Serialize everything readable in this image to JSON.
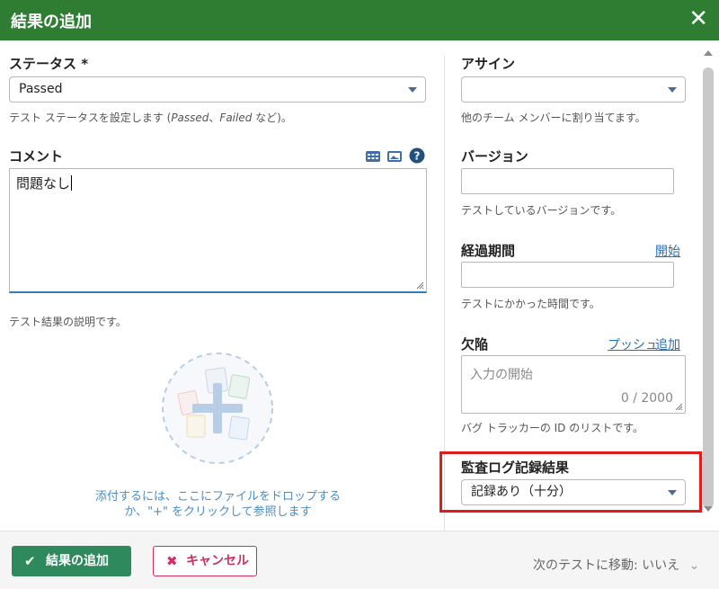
{
  "dialog": {
    "title": "結果の追加",
    "close_icon": "close-icon"
  },
  "left": {
    "status": {
      "label": "ステータス *",
      "value": "Passed",
      "help_prefix": "テスト ステータスを設定します (",
      "help_ex1": "Passed",
      "help_sep": "、",
      "help_ex2": "Failed",
      "help_suffix": " など)。"
    },
    "comment": {
      "label": "コメント",
      "value": "問題なし",
      "help": "テスト結果の説明です。",
      "toolbar_icons": [
        "table-icon",
        "image-icon",
        "help-icon"
      ]
    },
    "dropzone": {
      "line1": "添付するには、ここにファイルをドロップする",
      "line2": "か、\"+\" をクリックして参照します"
    }
  },
  "right": {
    "assign": {
      "label": "アサイン",
      "value": "",
      "help": "他のチーム メンバーに割り当てます。"
    },
    "version": {
      "label": "バージョン",
      "value": "",
      "help": "テストしているバージョンです。"
    },
    "elapsed": {
      "label": "経過期間",
      "start_link": "開始",
      "value": "",
      "help": "テストにかかった時間です。"
    },
    "defects": {
      "label": "欠陥",
      "push_link": "プッシュ",
      "add_link": "追加",
      "placeholder": "入力の開始",
      "counter": "0 / 2000",
      "help": "バグ トラッカーの ID のリストです。"
    },
    "audit": {
      "label": "監査ログ記録結果",
      "value": "記録あり（十分）"
    }
  },
  "footer": {
    "add_label": "結果の追加",
    "cancel_label": "キャンセル",
    "next_move": "次のテストに移動: いいえ"
  },
  "colors": {
    "titlebar": "#2e7d32",
    "primary_button": "#2e8a5d",
    "cancel": "#d12d5d",
    "link": "#2a6fb0",
    "highlight_box": "#e01b1b"
  }
}
